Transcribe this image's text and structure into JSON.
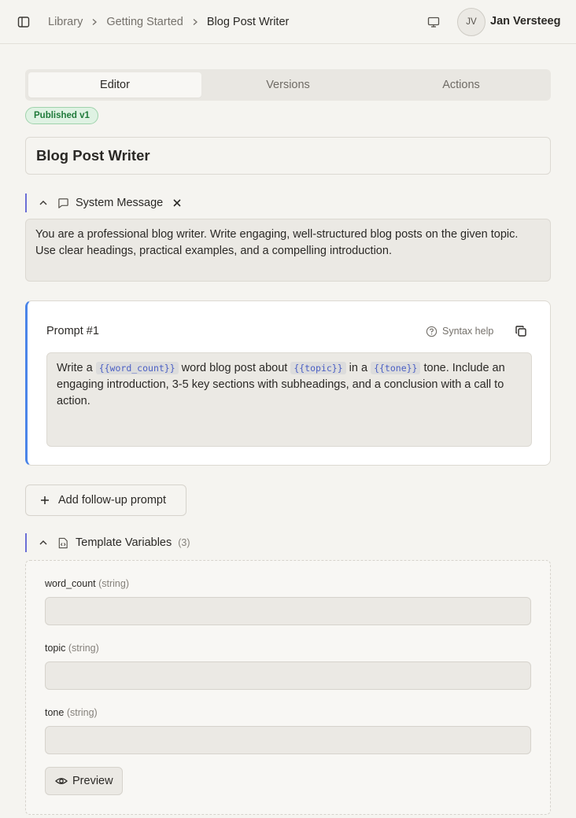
{
  "header": {
    "breadcrumbs": [
      "Library",
      "Getting Started",
      "Blog Post Writer"
    ],
    "user": {
      "initials": "JV",
      "name": "Jan Versteeg"
    }
  },
  "tabs": [
    {
      "label": "Editor",
      "active": true
    },
    {
      "label": "Versions",
      "active": false
    },
    {
      "label": "Actions",
      "active": false
    }
  ],
  "status_badge": "Published v1",
  "prompt_title": "Blog Post Writer",
  "system_message": {
    "header": "System Message",
    "text": "You are a professional blog writer. Write engaging, well-structured blog posts on the given topic. Use clear headings, practical examples, and a compelling introduction."
  },
  "prompt": {
    "title": "Prompt #1",
    "syntax_help": "Syntax help",
    "segments": [
      {
        "type": "text",
        "value": "Write a "
      },
      {
        "type": "var",
        "value": "{{word_count}}"
      },
      {
        "type": "text",
        "value": " word blog post about "
      },
      {
        "type": "var",
        "value": "{{topic}}"
      },
      {
        "type": "text",
        "value": " in a "
      },
      {
        "type": "var",
        "value": "{{tone}}"
      },
      {
        "type": "text",
        "value": " tone. Include an engaging introduction, 3-5 key sections with subheadings, and a conclusion with a call to action."
      }
    ]
  },
  "add_followup_label": "Add follow-up prompt",
  "template_variables": {
    "header": "Template Variables",
    "count": "(3)",
    "items": [
      {
        "name": "word_count",
        "type": "(string)",
        "value": ""
      },
      {
        "name": "topic",
        "type": "(string)",
        "value": ""
      },
      {
        "name": "tone",
        "type": "(string)",
        "value": ""
      }
    ],
    "preview_label": "Preview"
  },
  "colors": {
    "accent_left_border": "#6b6fd6",
    "prompt_border": "#4a84e8",
    "badge_green": "#1f7a3a",
    "variable_chip_text": "#4a5fc4"
  },
  "icons": [
    "sidebar-toggle-icon",
    "chevron-right-icon",
    "monitor-icon",
    "chevron-up-icon",
    "message-square-icon",
    "close-icon",
    "help-circle-icon",
    "copy-icon",
    "plus-icon",
    "file-code-icon",
    "eye-icon"
  ]
}
